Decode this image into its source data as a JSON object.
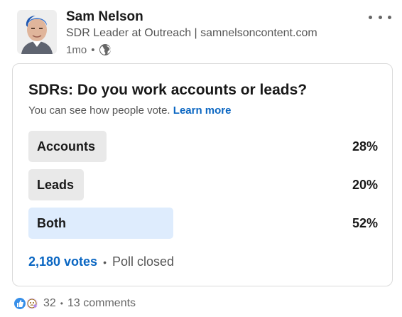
{
  "post": {
    "author_name": "Sam Nelson",
    "author_headline": "SDR Leader at Outreach | samnelsoncontent.com",
    "time_ago": "1mo",
    "separator": "•",
    "visibility_icon": "globe-icon"
  },
  "poll": {
    "question": "SDRs: Do you work accounts or leads?",
    "visibility_note": "You can see how people vote.",
    "learn_more": "Learn more",
    "options": [
      {
        "label": "Accounts",
        "percent_text": "28%",
        "percent": 28,
        "bar_color": "#e9e9e9"
      },
      {
        "label": "Leads",
        "percent_text": "20%",
        "percent": 20,
        "bar_color": "#e9e9e9"
      },
      {
        "label": "Both",
        "percent_text": "52%",
        "percent": 52,
        "bar_color": "#deecfd"
      }
    ],
    "votes": "2,180 votes",
    "separator": "•",
    "status": "Poll closed"
  },
  "social": {
    "reaction_icons": [
      "like-icon",
      "curious-icon"
    ],
    "reaction_count": "32",
    "separator": "•",
    "comments": "13 comments"
  },
  "colors": {
    "link_blue": "#0a66c2",
    "like_blue": "#378fe9",
    "winner_bar": "#deecfd",
    "neutral_bar": "#e9e9e9"
  }
}
